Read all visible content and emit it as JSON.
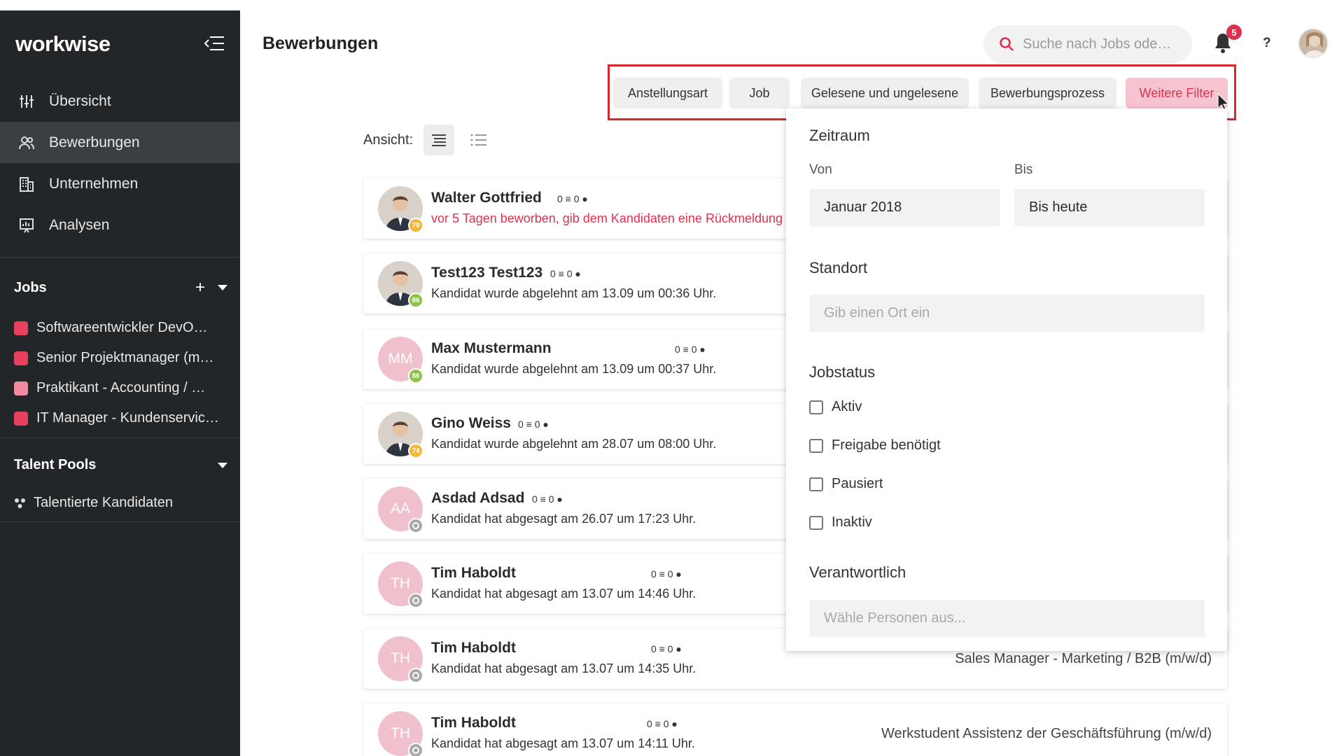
{
  "sidebar": {
    "logo": "workwise",
    "nav": [
      {
        "label": "Übersicht",
        "icon": "sliders-icon"
      },
      {
        "label": "Bewerbungen",
        "icon": "users-icon",
        "active": true
      },
      {
        "label": "Unternehmen",
        "icon": "building-icon"
      },
      {
        "label": "Analysen",
        "icon": "chart-icon"
      }
    ],
    "jobs_title": "Jobs",
    "jobs_add": "+",
    "jobs": [
      {
        "label": "Softwareentwickler DevO…",
        "color": "#e8415f"
      },
      {
        "label": "Senior Projektmanager (m…",
        "color": "#e8415f"
      },
      {
        "label": "Praktikant - Accounting / …",
        "color": "#f08aa0"
      },
      {
        "label": "IT Manager - Kundenservic…",
        "color": "#e8415f"
      }
    ],
    "pools_title": "Talent Pools",
    "pools": [
      {
        "label": "Talentierte Kandidaten"
      }
    ]
  },
  "header": {
    "title": "Bewerbungen",
    "search_placeholder": "Suche nach Jobs ode…",
    "notifications": "5",
    "help": "?"
  },
  "filters": [
    {
      "label": "Anstellungsart"
    },
    {
      "label": "Job"
    },
    {
      "label": "Gelesene und ungelesene"
    },
    {
      "label": "Bewerbungsprozess"
    },
    {
      "label": "Weitere Filter",
      "active": true
    }
  ],
  "view": {
    "label": "Ansicht:"
  },
  "candidates": [
    {
      "name": "Walter Gottfried",
      "counts": "0 ≡ 0 ●",
      "status": "vor 5 Tagen beworben, gib dem Kandidaten eine Rückmeldung",
      "warn": true,
      "score": "79",
      "score_color": "#f2b733",
      "photo": true,
      "job": ""
    },
    {
      "name": "Test123 Test123",
      "counts": "0 ≡ 0 ●",
      "status": "Kandidat wurde abgelehnt am 13.09 um 00:36 Uhr.",
      "score": "86",
      "score_color": "#8dc24a",
      "photo": true,
      "job": ""
    },
    {
      "name": "Max Mustermann",
      "initials": "MM",
      "counts": "0 ≡ 0 ●",
      "status": "Kandidat wurde abgelehnt am 13.09 um 00:37 Uhr.",
      "score": "86",
      "score_color": "#8dc24a",
      "job": ""
    },
    {
      "name": "Gino Weiss",
      "counts": "0 ≡ 0 ●",
      "status": "Kandidat wurde abgelehnt am 28.07 um 08:00 Uhr.",
      "score": "74",
      "score_color": "#f2b733",
      "photo": true,
      "job": ""
    },
    {
      "name": "Asdad Adsad",
      "initials": "AA",
      "counts": "0 ≡ 0 ●",
      "status": "Kandidat hat abgesagt am 26.07 um 17:23 Uhr.",
      "score": "",
      "score_color": "#a8a8a8",
      "job": ""
    },
    {
      "name": "Tim Haboldt",
      "initials": "TH",
      "counts": "0 ≡ 0 ●",
      "status": "Kandidat hat abgesagt am 13.07 um 14:46 Uhr.",
      "score": "",
      "score_color": "#a8a8a8",
      "job": ""
    },
    {
      "name": "Tim Haboldt",
      "initials": "TH",
      "counts": "0 ≡ 0 ●",
      "status": "Kandidat hat abgesagt am 13.07 um 14:35 Uhr.",
      "score": "",
      "score_color": "#a8a8a8",
      "job": "Sales Manager - Marketing / B2B (m/w/d)"
    },
    {
      "name": "Tim Haboldt",
      "initials": "TH",
      "counts": "0 ≡ 0 ●",
      "status": "Kandidat hat abgesagt am 13.07 um 14:11 Uhr.",
      "score": "",
      "score_color": "#a8a8a8",
      "job": "Werkstudent Assistenz der Geschäftsführung (m/w/d)"
    }
  ],
  "panel": {
    "zeitraum": "Zeitraum",
    "von_label": "Von",
    "von_value": "Januar 2018",
    "bis_label": "Bis",
    "bis_value": "Bis heute",
    "standort": "Standort",
    "standort_placeholder": "Gib einen Ort ein",
    "jobstatus": "Jobstatus",
    "statuses": [
      "Aktiv",
      "Freigabe benötigt",
      "Pausiert",
      "Inaktiv"
    ],
    "verantwortlich": "Verantwortlich",
    "verantwortlich_placeholder": "Wähle Personen aus..."
  },
  "colors": {
    "accent": "#e0304f",
    "sidebar": "#222629",
    "highlight_box": "#d8262b"
  }
}
